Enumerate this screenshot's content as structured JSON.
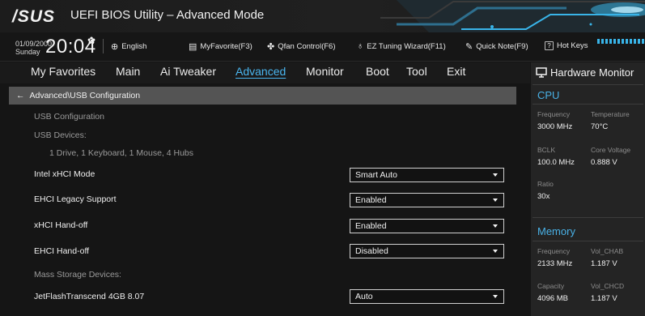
{
  "titlebar": {
    "logo": "/SUS",
    "title": "UEFI BIOS Utility – Advanced Mode"
  },
  "infobar": {
    "date": "01/09/2000",
    "day": "Sunday",
    "time": "20:04",
    "tools": {
      "language": "English",
      "myfavorite": "MyFavorite(F3)",
      "qfan": "Qfan Control(F6)",
      "ez_tuning": "EZ Tuning Wizard(F11)",
      "quick_note": "Quick Note(F9)",
      "hot_keys": "Hot Keys",
      "hot_keys_box": "?"
    }
  },
  "menu": {
    "items": [
      "My Favorites",
      "Main",
      "Ai Tweaker",
      "Advanced",
      "Monitor",
      "Boot",
      "Tool",
      "Exit"
    ],
    "active": "Advanced"
  },
  "breadcrumb": "Advanced\\USB Configuration",
  "usb": {
    "section_title": "USB Configuration",
    "devices_label": "USB Devices:",
    "devices_value": "1 Drive, 1 Keyboard, 1 Mouse, 4 Hubs",
    "settings": [
      {
        "label": "Intel xHCI Mode",
        "value": "Smart Auto"
      },
      {
        "label": "EHCI Legacy Support",
        "value": "Enabled"
      },
      {
        "label": "xHCI Hand-off",
        "value": "Enabled"
      },
      {
        "label": "EHCI Hand-off",
        "value": "Disabled"
      }
    ],
    "mass_storage_label": "Mass Storage Devices:",
    "mass_storage": {
      "label": "JetFlashTranscend 4GB 8.07",
      "value": "Auto"
    }
  },
  "hardware_monitor": {
    "title": "Hardware Monitor",
    "cpu": {
      "title": "CPU",
      "frequency_label": "Frequency",
      "frequency": "3000 MHz",
      "temperature_label": "Temperature",
      "temperature": "70°C",
      "bclk_label": "BCLK",
      "bclk": "100.0 MHz",
      "core_voltage_label": "Core Voltage",
      "core_voltage": "0.888 V",
      "ratio_label": "Ratio",
      "ratio": "30x"
    },
    "memory": {
      "title": "Memory",
      "frequency_label": "Frequency",
      "frequency": "2133 MHz",
      "vol_chab_label": "Vol_CHAB",
      "vol_chab": "1.187 V",
      "capacity_label": "Capacity",
      "capacity": "4096 MB",
      "vol_chcd_label": "Vol_CHCD",
      "vol_chcd": "1.187 V"
    }
  },
  "colors": {
    "accent": "#4ab6f0",
    "background": "#151515",
    "breadcrumb_bg": "#545454",
    "monitor_bg": "#242424"
  }
}
